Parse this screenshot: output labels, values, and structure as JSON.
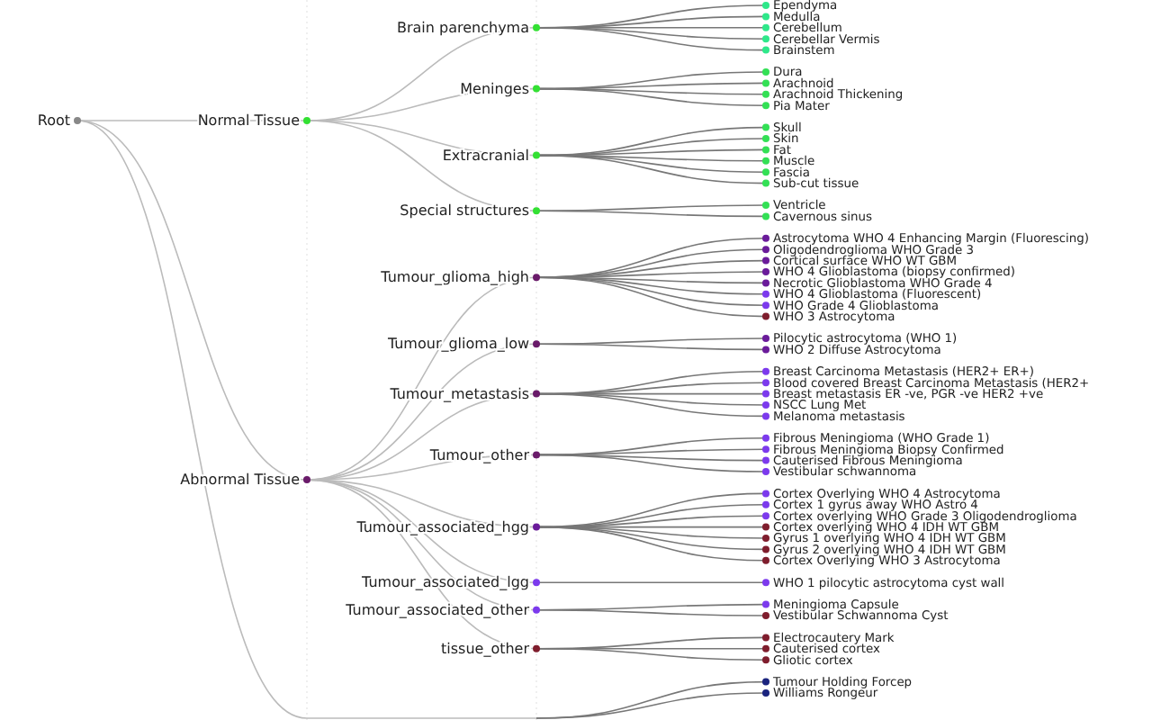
{
  "tree": {
    "label": "Root",
    "color": "#888888",
    "children": [
      {
        "label": "Normal Tissue",
        "color": "#33e033",
        "children": [
          {
            "label": "Brain parenchyma",
            "color": "#33e033",
            "children": [
              {
                "label": "Ependyma",
                "color": "#2ee88a"
              },
              {
                "label": "Medulla",
                "color": "#2ee88a"
              },
              {
                "label": "Cerebellum",
                "color": "#2ee88a"
              },
              {
                "label": "Cerebellar Vermis",
                "color": "#2ee88a"
              },
              {
                "label": "Brainstem",
                "color": "#2ee88a"
              }
            ]
          },
          {
            "label": "Meninges",
            "color": "#33e033",
            "children": [
              {
                "label": "Dura",
                "color": "#33e055"
              },
              {
                "label": "Arachnoid",
                "color": "#33e055"
              },
              {
                "label": "Arachnoid Thickening",
                "color": "#33e055"
              },
              {
                "label": "Pia Mater",
                "color": "#33e055"
              }
            ]
          },
          {
            "label": "Extracranial",
            "color": "#33e033",
            "children": [
              {
                "label": "Skull",
                "color": "#33e055"
              },
              {
                "label": "Skin",
                "color": "#33e055"
              },
              {
                "label": "Fat",
                "color": "#33e055"
              },
              {
                "label": "Muscle",
                "color": "#33e055"
              },
              {
                "label": "Fascia",
                "color": "#33e055"
              },
              {
                "label": "Sub-cut tissue",
                "color": "#33e055"
              }
            ]
          },
          {
            "label": "Special structures",
            "color": "#33e033",
            "children": [
              {
                "label": "Ventricle",
                "color": "#33e055"
              },
              {
                "label": "Cavernous sinus",
                "color": "#33e055"
              }
            ]
          }
        ]
      },
      {
        "label": "Abnormal Tissue",
        "color": "#6a1b6a",
        "children": [
          {
            "label": "Tumour_glioma_high",
            "color": "#6a1b6a",
            "children": [
              {
                "label": "Astrocytoma WHO 4 Enhancing Margin (Fluorescing)",
                "color": "#6a1b9a"
              },
              {
                "label": "Oligodendroglioma WHO Grade 3",
                "color": "#6a1b9a"
              },
              {
                "label": "Cortical surface WHO WT GBM",
                "color": "#6a1b9a"
              },
              {
                "label": "WHO 4 Glioblastoma (biopsy confirmed)",
                "color": "#6a1b9a"
              },
              {
                "label": "Necrotic Glioblastoma WHO Grade 4",
                "color": "#6a1b9a"
              },
              {
                "label": "WHO 4 Glioblastoma (Fluorescent)",
                "color": "#7c3aed"
              },
              {
                "label": "WHO Grade 4 Glioblastoma",
                "color": "#7c3aed"
              },
              {
                "label": "WHO 3 Astrocytoma",
                "color": "#7f1d2d"
              }
            ]
          },
          {
            "label": "Tumour_glioma_low",
            "color": "#6a1b6a",
            "children": [
              {
                "label": "Pilocytic astrocytoma (WHO 1)",
                "color": "#6a1b9a"
              },
              {
                "label": "WHO 2 Diffuse Astrocytoma",
                "color": "#6a1b9a"
              }
            ]
          },
          {
            "label": "Tumour_metastasis",
            "color": "#6a1b6a",
            "children": [
              {
                "label": "Breast Carcinoma Metastasis (HER2+ ER+)",
                "color": "#7c3aed"
              },
              {
                "label": "Blood covered Breast Carcinoma Metastasis (HER2+",
                "color": "#7c3aed"
              },
              {
                "label": "Breast metastasis ER -ve, PGR -ve HER2 +ve",
                "color": "#7c3aed"
              },
              {
                "label": "NSCC Lung Met",
                "color": "#7c3aed"
              },
              {
                "label": "Melanoma metastasis",
                "color": "#7c3aed"
              }
            ]
          },
          {
            "label": "Tumour_other",
            "color": "#6a1b6a",
            "children": [
              {
                "label": "Fibrous Meningioma (WHO Grade 1)",
                "color": "#7c3aed"
              },
              {
                "label": "Fibrous Meningioma Biopsy Confirmed",
                "color": "#7c3aed"
              },
              {
                "label": "Cauterised Fibrous Meningioma",
                "color": "#7c3aed"
              },
              {
                "label": "Vestibular schwannoma",
                "color": "#7c3aed"
              }
            ]
          },
          {
            "label": "Tumour_associated_hgg",
            "color": "#6a1b9a",
            "children": [
              {
                "label": "Cortex Overlying WHO 4 Astrocytoma",
                "color": "#7c3aed"
              },
              {
                "label": "Cortex 1 gyrus away WHO Astro 4",
                "color": "#7c3aed"
              },
              {
                "label": "Cortex overlying WHO Grade 3 Oligodendroglioma",
                "color": "#7c3aed"
              },
              {
                "label": "Cortex overlying WHO 4 IDH WT GBM",
                "color": "#7f1d2d"
              },
              {
                "label": "Gyrus 1 overlying WHO 4 IDH WT GBM",
                "color": "#7f1d2d"
              },
              {
                "label": "Gyrus 2 overlying WHO 4 IDH WT GBM",
                "color": "#7f1d2d"
              },
              {
                "label": "Cortex Overlying WHO 3 Astrocytoma",
                "color": "#7f1d2d"
              }
            ]
          },
          {
            "label": "Tumour_associated_lgg",
            "color": "#7c3aed",
            "children": [
              {
                "label": "WHO 1 pilocytic astrocytoma cyst wall",
                "color": "#7c3aed"
              }
            ]
          },
          {
            "label": "Tumour_associated_other",
            "color": "#7c3aed",
            "children": [
              {
                "label": "Meningioma Capsule",
                "color": "#7c3aed"
              },
              {
                "label": "Vestibular Schwannoma Cyst",
                "color": "#7f1d2d"
              }
            ]
          },
          {
            "label": "tissue_other",
            "color": "#7f1d2d",
            "children": [
              {
                "label": "Electrocautery Mark",
                "color": "#7f1d2d"
              },
              {
                "label": "Cauterised cortex",
                "color": "#7f1d2d"
              },
              {
                "label": "Gliotic cortex",
                "color": "#7f1d2d"
              }
            ]
          }
        ]
      },
      {
        "children": [
          {
            "children": [
              {
                "label": "Tumour Holding Forcep",
                "color": "#1a237e"
              },
              {
                "label": "Williams Rongeur",
                "color": "#1a237e"
              }
            ]
          }
        ]
      }
    ]
  }
}
